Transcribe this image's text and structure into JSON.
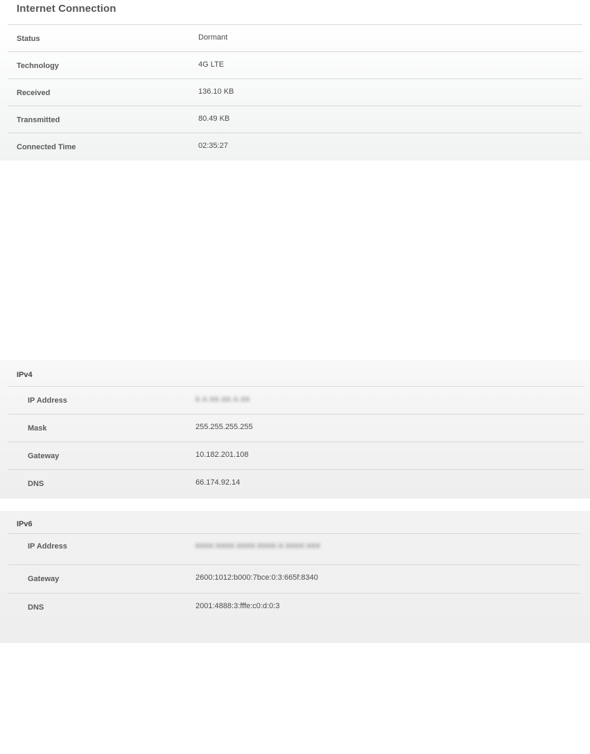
{
  "internet_connection": {
    "title": "Internet Connection",
    "rows": [
      {
        "label": "Status",
        "value": "Dormant"
      },
      {
        "label": "Technology",
        "value": "4G LTE"
      },
      {
        "label": "Received",
        "value": "136.10 KB"
      },
      {
        "label": "Transmitted",
        "value": "80.49 KB"
      },
      {
        "label": "Connected Time",
        "value": "02:35:27"
      }
    ]
  },
  "ipv4": {
    "title": "IPv4",
    "rows": [
      {
        "label": "IP Address",
        "value": "x.x.xx.xx.x.xx"
      },
      {
        "label": "Mask",
        "value": "255.255.255.255"
      },
      {
        "label": "Gateway",
        "value": "10.182.201.108"
      },
      {
        "label": "DNS",
        "value": "66.174.92.14"
      }
    ]
  },
  "ipv6": {
    "title": "IPv6",
    "rows": [
      {
        "label": "IP Address",
        "value": "xxxx:xxxx:xxxx:xxxx:x:xxxx:xxx"
      },
      {
        "label": "Gateway",
        "value": "2600:1012:b000:7bce:0:3:665f:8340"
      },
      {
        "label": "DNS",
        "value": "2001:4888:3:fffe:c0:d:0:3"
      }
    ]
  }
}
